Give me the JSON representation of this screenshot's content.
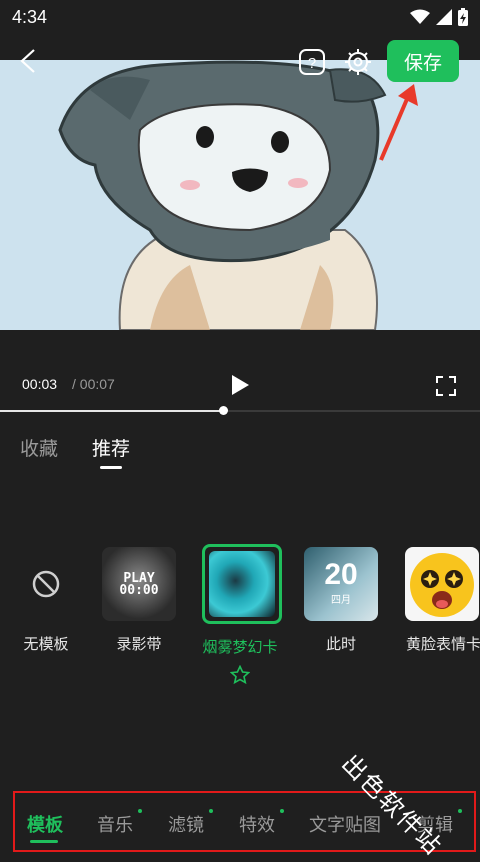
{
  "status": {
    "time": "4:34"
  },
  "header": {
    "save_label": "保存"
  },
  "player": {
    "current_time": "00:03",
    "separator": " / ",
    "total_time": "00:07",
    "progress": 0.465
  },
  "categories": [
    {
      "label": "收藏",
      "active": false
    },
    {
      "label": "推荐",
      "active": true
    }
  ],
  "templates": [
    {
      "label": "无模板",
      "selected": false
    },
    {
      "label": "录影带",
      "selected": false,
      "thumb_text_1": "PLAY",
      "thumb_text_2": "00:00"
    },
    {
      "label": "烟雾梦幻卡",
      "selected": true
    },
    {
      "label": "此时",
      "selected": false,
      "thumb_text_1": "20",
      "thumb_text_2": "四月"
    },
    {
      "label": "黄脸表情卡",
      "selected": false
    }
  ],
  "bottom_tabs": [
    {
      "label": "模板",
      "active": true,
      "dot": false
    },
    {
      "label": "音乐",
      "active": false,
      "dot": true
    },
    {
      "label": "滤镜",
      "active": false,
      "dot": true
    },
    {
      "label": "特效",
      "active": false,
      "dot": true
    },
    {
      "label": "文字贴图",
      "active": false,
      "dot": false
    },
    {
      "label": "剪辑",
      "active": false,
      "dot": true
    }
  ],
  "watermark": "出色软件站",
  "colors": {
    "accent": "#1fbf5c",
    "highlight_frame": "#e21a1a",
    "annotation_arrow": "#e83a2a"
  }
}
